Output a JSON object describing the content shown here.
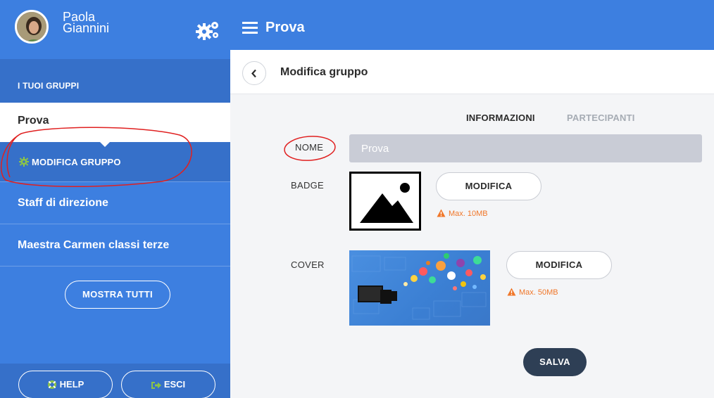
{
  "user": {
    "first_name": "Paola",
    "last_name": "Giannini"
  },
  "sidebar": {
    "groups_header": "I TUOI GRUPPI",
    "active_group": "Prova",
    "active_subitem": "MODIFICA GRUPPO",
    "items": [
      {
        "label": "Staff di direzione"
      },
      {
        "label": "Maestra Carmen classi terze"
      }
    ],
    "show_all": "MOSTRA TUTTI",
    "help": "HELP",
    "exit": "ESCI"
  },
  "topbar": {
    "title": "Prova"
  },
  "subheader": {
    "title": "Modifica gruppo"
  },
  "tabs": {
    "info": "INFORMAZIONI",
    "participants": "PARTECIPANTI"
  },
  "form": {
    "nome_label": "NOME",
    "nome_value": "Prova",
    "badge_label": "BADGE",
    "badge_button": "MODIFICA",
    "badge_limit": "Max. 10MB",
    "cover_label": "COVER",
    "cover_button": "MODIFICA",
    "cover_limit": "Max. 50MB",
    "save": "SALVA"
  },
  "colors": {
    "primary": "#3d7fe0",
    "primary_dark": "#3670c9",
    "accent_green": "#8bc34a",
    "warning": "#f0772a",
    "save_button": "#2e3f55",
    "annotation": "#e02020"
  }
}
